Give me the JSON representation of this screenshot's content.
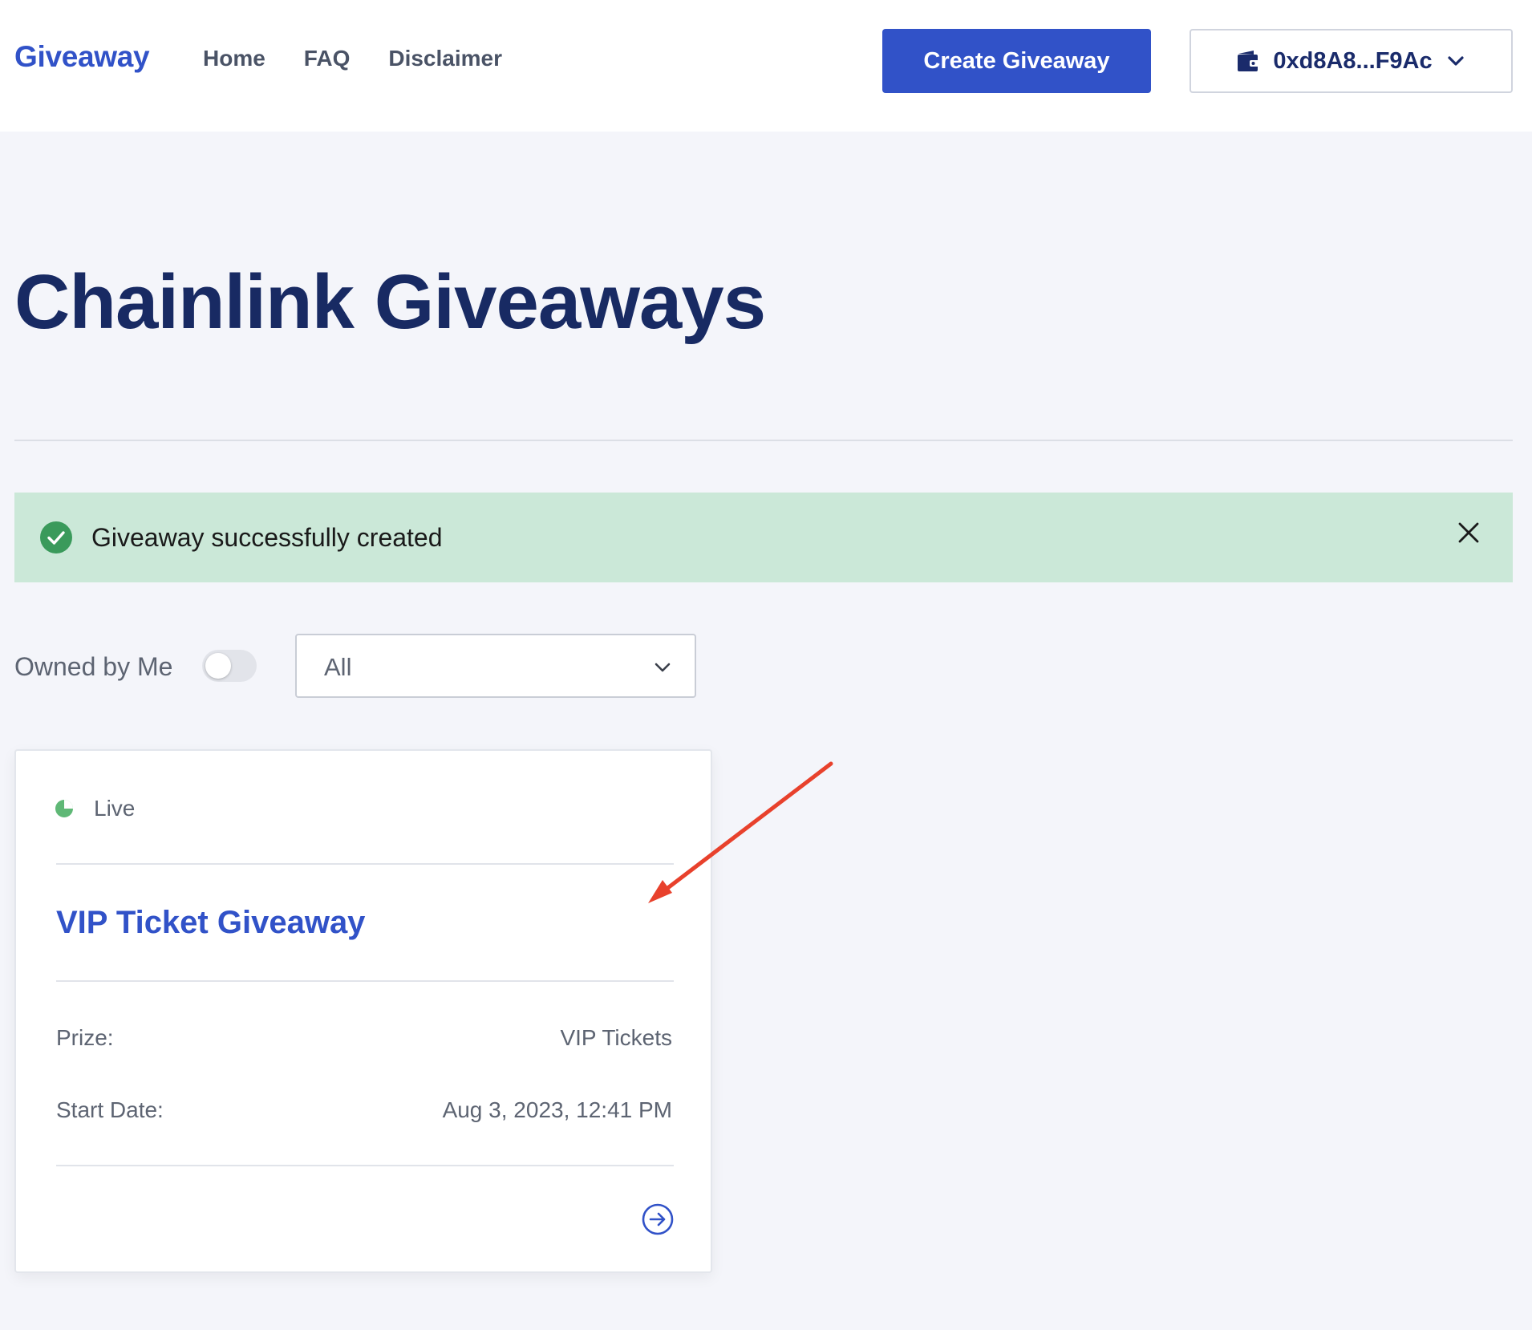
{
  "header": {
    "brand": "Giveaway",
    "nav": [
      "Home",
      "FAQ",
      "Disclaimer"
    ],
    "create_button": "Create Giveaway",
    "wallet_address": "0xd8A8...F9Ac"
  },
  "page": {
    "title": "Chainlink Giveaways"
  },
  "alert": {
    "message": "Giveaway successfully created",
    "color": "#cbe8d8"
  },
  "filters": {
    "owned_by_me_label": "Owned by Me",
    "owned_by_me": false,
    "status_select": "All"
  },
  "giveaway_card": {
    "status": "Live",
    "title": "VIP Ticket Giveaway",
    "prize_label": "Prize:",
    "prize_value": "VIP Tickets",
    "start_date_label": "Start Date:",
    "start_date_value": "Aug 3, 2023, 12:41 PM"
  },
  "colors": {
    "accent": "#3152c8",
    "title": "#182a63",
    "success": "#3a9a5b",
    "annotation_arrow": "#e8412c"
  },
  "icons": [
    "wallet-icon",
    "chevron-down-icon",
    "check-circle-icon",
    "close-icon",
    "live-status-icon",
    "arrow-right-circle-icon"
  ]
}
